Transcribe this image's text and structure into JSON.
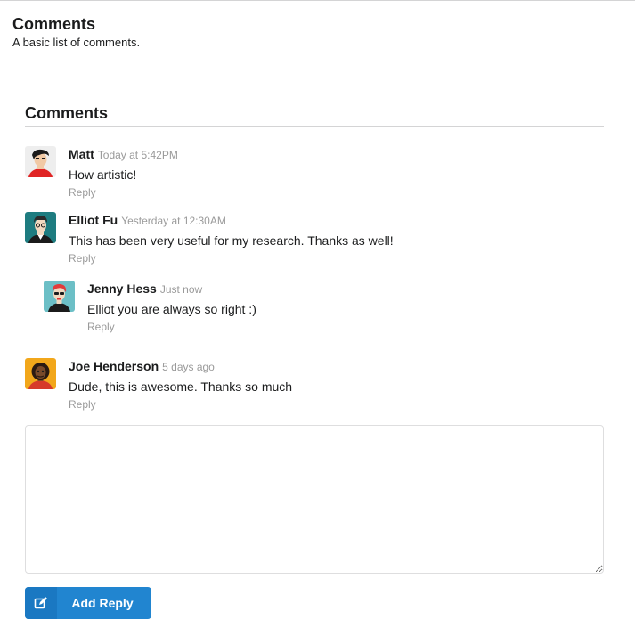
{
  "page": {
    "title": "Comments",
    "subtitle": "A basic list of comments."
  },
  "comments_header": "Comments",
  "comments": [
    {
      "author": "Matt",
      "time": "Today at 5:42PM",
      "text": "How artistic!",
      "reply": "Reply"
    },
    {
      "author": "Elliot Fu",
      "time": "Yesterday at 12:30AM",
      "text": "This has been very useful for my research. Thanks as well!",
      "reply": "Reply"
    },
    {
      "author": "Jenny Hess",
      "time": "Just now",
      "text": "Elliot you are always so right :)",
      "reply": "Reply"
    },
    {
      "author": "Joe Henderson",
      "time": "5 days ago",
      "text": "Dude, this is awesome. Thanks so much",
      "reply": "Reply"
    }
  ],
  "reply_form": {
    "textarea_value": "",
    "button_label": "Add Reply",
    "button_icon": "edit-icon"
  },
  "colors": {
    "primary_button": "#2185d0",
    "metadata": "#9a9a9a"
  }
}
